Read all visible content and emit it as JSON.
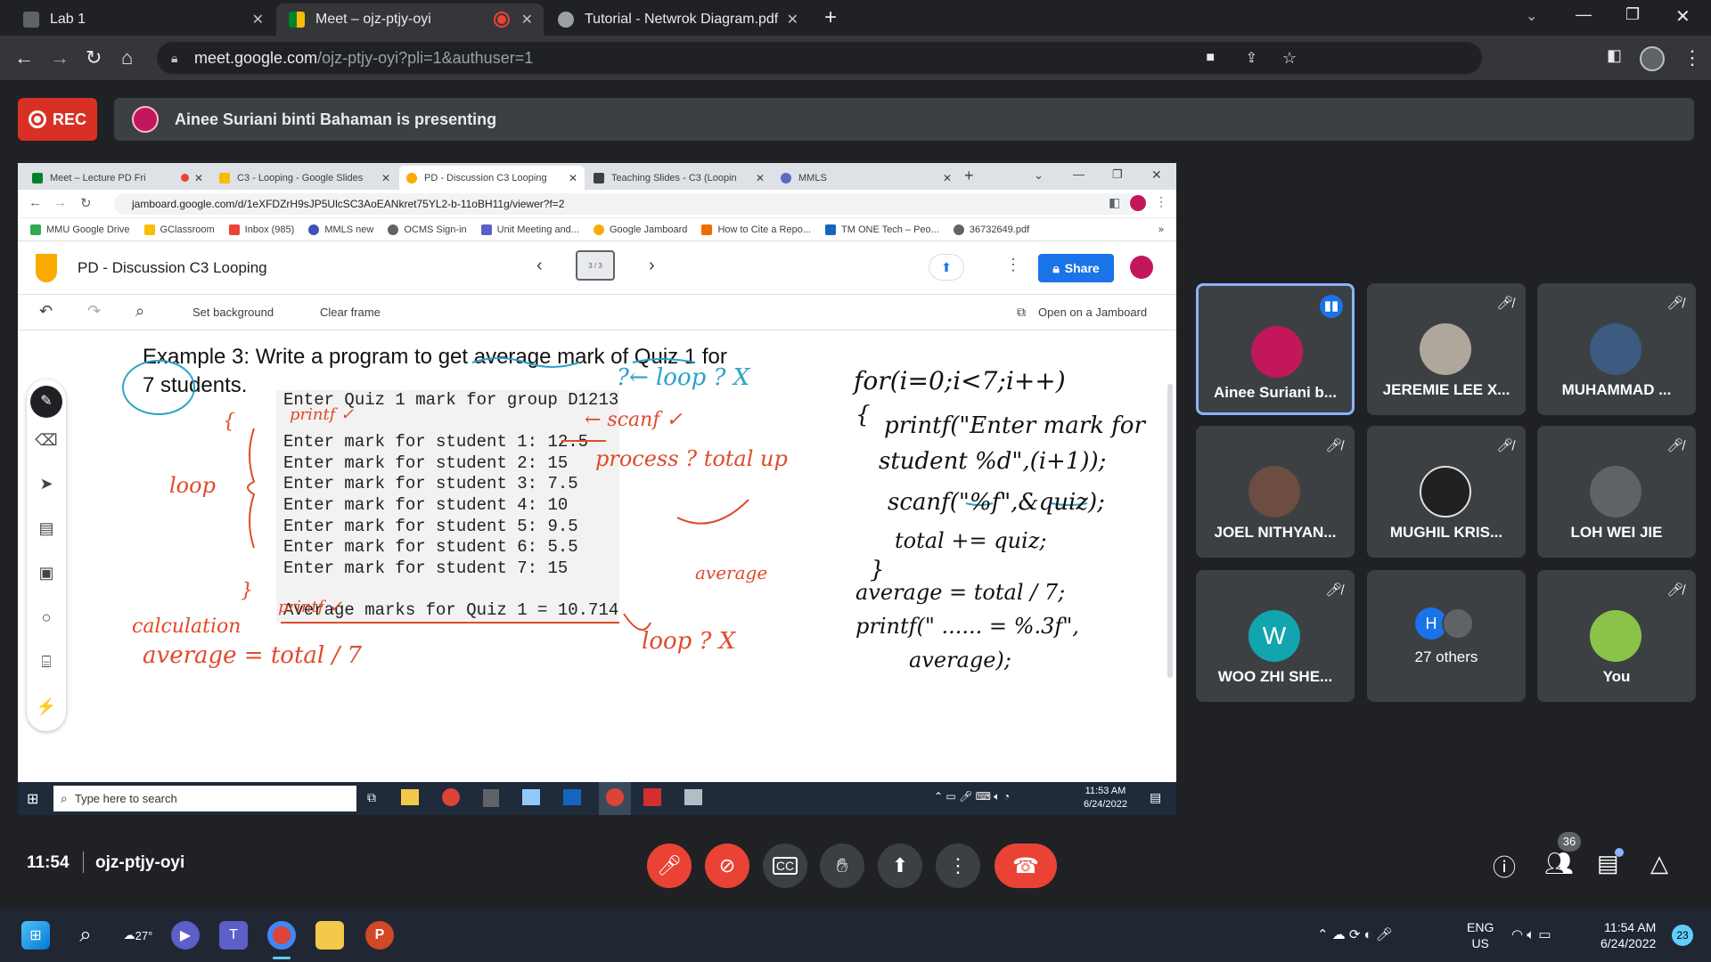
{
  "browser": {
    "tabs": [
      {
        "title": "Lab 1",
        "active": false
      },
      {
        "title": "Meet – ojz-ptjy-oyi",
        "active": true
      },
      {
        "title": "Tutorial - Netwrok Diagram.pdf",
        "active": false
      }
    ],
    "url_host": "meet.google.com",
    "url_path": "/ojz-ptjy-oyi?pli=1&authuser=1"
  },
  "meet": {
    "rec_label": "REC",
    "presenting_text": "Ainee Suriani binti Bahaman is presenting",
    "time": "11:54",
    "meeting_code": "ojz-ptjy-oyi",
    "people_count": "36",
    "participants": [
      {
        "name": "Ainee Suriani b...",
        "speaking": true,
        "avatar_color": "#c2185b",
        "initial": ""
      },
      {
        "name": "JEREMIE LEE X...",
        "speaking": false,
        "avatar_color": "#b0a79c",
        "initial": ""
      },
      {
        "name": "MUHAMMAD ...",
        "speaking": false,
        "avatar_color": "#3d5a80",
        "initial": ""
      },
      {
        "name": "JOEL NITHYAN...",
        "speaking": false,
        "avatar_color": "#6d4c41",
        "initial": ""
      },
      {
        "name": "MUGHIL KRIS...",
        "speaking": false,
        "avatar_color": "#212121",
        "initial": ""
      },
      {
        "name": "LOH WEI JIE",
        "speaking": false,
        "avatar_color": "#5f6368",
        "initial": ""
      },
      {
        "name": "WOO ZHI SHE...",
        "speaking": false,
        "avatar_color": "#12a4af",
        "initial": "W"
      },
      {
        "name": "27 others",
        "speaking": false,
        "avatar_color": "#1a73e8",
        "initial": "H"
      },
      {
        "name": "You",
        "speaking": false,
        "avatar_color": "#8bc34a",
        "initial": ""
      }
    ]
  },
  "shared": {
    "tabs": [
      {
        "title": "Meet – Lecture PD Fri"
      },
      {
        "title": "C3 - Looping - Google Slides"
      },
      {
        "title": "PD - Discussion C3 Looping"
      },
      {
        "title": "Teaching Slides - C3 (Loopin"
      },
      {
        "title": "MMLS"
      }
    ],
    "url": "jamboard.google.com/d/1eXFDZrH9sJP5UlcSC3AoEANkret75YL2-b-11oBH11g/viewer?f=2",
    "bookmarks": [
      "MMU Google Drive",
      "GClassroom",
      "Inbox (985)",
      "MMLS new",
      "OCMS Sign-in",
      "Unit Meeting and...",
      "Google Jamboard",
      "How to Cite a Repo...",
      "TM ONE Tech – Peo...",
      "36732649.pdf"
    ],
    "jam_title": "PD - Discussion C3 Looping",
    "frame_indicator": "3 / 3",
    "share_label": "Share",
    "toolbar": {
      "set_background": "Set background",
      "clear_frame": "Clear frame",
      "open_on_jamboard": "Open on a Jamboard"
    },
    "example_text_1": "Example 3: Write a program to get average mark of Quiz 1 for",
    "example_text_2": "7 students.",
    "console_lines": [
      "Enter Quiz 1 mark for group D1213",
      "",
      "Enter mark for student 1: 12.5",
      "Enter mark for student 2: 15",
      "Enter mark for student 3: 7.5",
      "Enter mark for student 4: 10",
      "Enter mark for student 5: 9.5",
      "Enter mark for student 6: 5.5",
      "Enter mark for student 7: 15",
      "",
      "Average marks for Quiz 1 = 10.714"
    ],
    "handwriting": {
      "q_loop": "?← loop ? X",
      "scanf": "← scanf ✓",
      "printf1": "printf ✓",
      "printf2": "printf ✓",
      "loop_left": "loop",
      "process": "process ? total up",
      "average_word": "average",
      "calc": "calculation",
      "calc_eq": "average = total / 7",
      "loop_x": "loop ? X",
      "brace_open": "{",
      "brace_close": "}",
      "code_1": "for(i=0;i<7;i++)",
      "code_2": "{",
      "code_3": "printf(\"Enter mark for",
      "code_4": "student %d\",(i+1));",
      "code_5": "scanf(\"%f\",&quiz);",
      "code_6": "total += quiz;",
      "code_7": "}",
      "code_8": "average = total / 7;",
      "code_9": "printf(\" ...... = %.3f\",",
      "code_10": "average);"
    },
    "taskbar": {
      "search_placeholder": "Type here to search",
      "time": "11:53 AM",
      "date": "6/24/2022"
    }
  },
  "windows": {
    "temp": "27°",
    "lang_1": "ENG",
    "lang_2": "US",
    "time": "11:54 AM",
    "date": "6/24/2022",
    "notif_count": "23"
  }
}
